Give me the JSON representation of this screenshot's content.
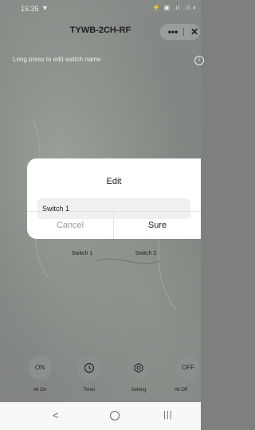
{
  "status_bar": {
    "time": "15:35",
    "right_indicators": "⚡ ▣ .ıl .ıl ◐"
  },
  "header": {
    "title": "TYWB-2CH-RF",
    "more_label": "•••",
    "close_label": "✕"
  },
  "hint": {
    "text": "Long press to edit switch name"
  },
  "switches": [
    {
      "name": "Switch 1"
    },
    {
      "name": "Switch 2"
    }
  ],
  "edit_dialog": {
    "title": "Edit",
    "input_value": "Switch 1",
    "cancel_label": "Cancel",
    "confirm_label": "Sure"
  },
  "actions": [
    {
      "icon": "on-icon",
      "glyph": "ON",
      "label": "All On"
    },
    {
      "icon": "clock-icon",
      "glyph": "",
      "label": "Timer"
    },
    {
      "icon": "gear-icon",
      "glyph": "",
      "label": "Setting"
    },
    {
      "icon": "off-icon",
      "glyph": "OFF",
      "label": "All Off"
    }
  ],
  "nav": {
    "back": "<",
    "recent": "|||"
  }
}
